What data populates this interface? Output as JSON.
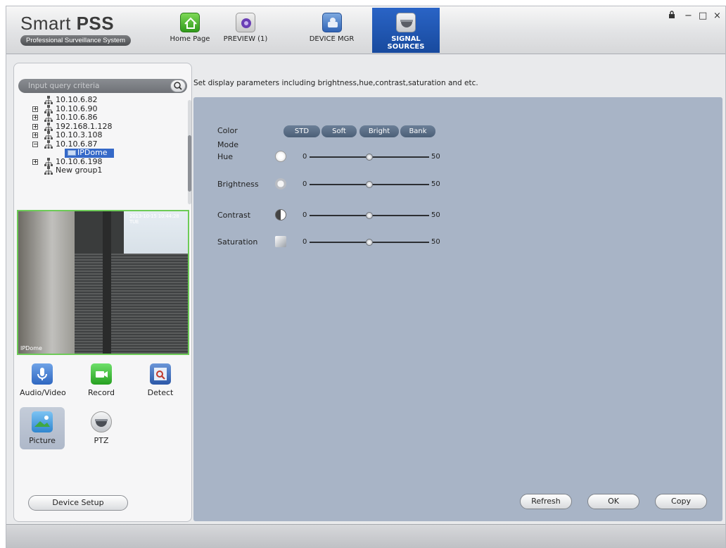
{
  "app": {
    "brand_name": "Smart",
    "brand_name_bold": "PSS",
    "brand_subtitle": "Professional Surveillance System"
  },
  "tabs": [
    {
      "label": "Home Page",
      "icon": "home-icon",
      "active": false
    },
    {
      "label": "PREVIEW (1)",
      "icon": "camera-lens-icon",
      "active": false
    },
    {
      "label": "DEVICE MGR",
      "icon": "device-icon",
      "active": false
    },
    {
      "label": "SIGNAL SOURCES",
      "icon": "dome-camera-icon",
      "active": true
    }
  ],
  "window_controls": {
    "lock": "lock-icon",
    "minimize": "−",
    "maximize": "□",
    "close": "×"
  },
  "search": {
    "placeholder": "Input query criteria"
  },
  "tree": [
    {
      "label": "10.10.6.82",
      "expander": ""
    },
    {
      "label": "10.10.6.90",
      "expander": "+"
    },
    {
      "label": "10.10.6.86",
      "expander": "+"
    },
    {
      "label": "192.168.1.128",
      "expander": "+"
    },
    {
      "label": "10.10.3.108",
      "expander": "+"
    },
    {
      "label": "10.10.6.87",
      "expander": "−"
    },
    {
      "label": "IPDome",
      "selected": true
    },
    {
      "label": "10.10.6.198",
      "expander": "+"
    },
    {
      "label": "New group1",
      "expander": ""
    }
  ],
  "preview": {
    "channel_name": "IPDome",
    "timestamp": "2013-10-15 10:44:28 TUE"
  },
  "tools": [
    {
      "label": "Audio/Video",
      "icon": "microphone-icon"
    },
    {
      "label": "Record",
      "icon": "video-camera-icon"
    },
    {
      "label": "Detect",
      "icon": "detect-icon"
    },
    {
      "label": "Picture",
      "icon": "picture-icon",
      "active": true
    },
    {
      "label": "PTZ",
      "icon": "ptz-dome-icon"
    }
  ],
  "device_setup_label": "Device Setup",
  "description": "Set display parameters including brightness,hue,contrast,saturation and etc.",
  "color_mode": {
    "label": "Color Mode",
    "options": [
      "STD",
      "Soft",
      "Bright",
      "Bank"
    ]
  },
  "sliders": [
    {
      "label": "Hue",
      "min": "0",
      "value": "50",
      "level": 0.5,
      "icon": "palette-icon"
    },
    {
      "label": "Brightness",
      "min": "0",
      "value": "50",
      "level": 0.5,
      "icon": "sun-icon"
    },
    {
      "label": "Contrast",
      "min": "0",
      "value": "50",
      "level": 0.5,
      "icon": "contrast-icon"
    },
    {
      "label": "Saturation",
      "min": "0",
      "value": "50",
      "level": 0.5,
      "icon": "paint-icon"
    }
  ],
  "buttons": {
    "refresh": "Refresh",
    "ok": "OK",
    "copy": "Copy"
  }
}
